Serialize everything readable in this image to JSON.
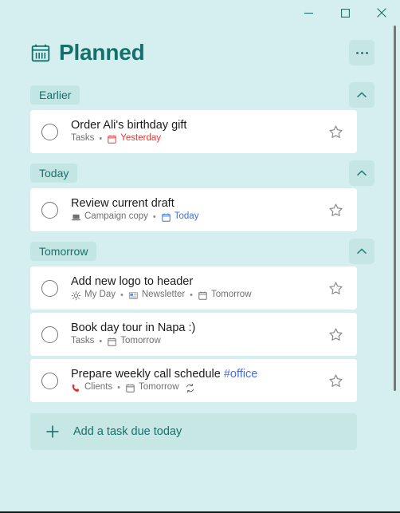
{
  "window": {
    "controls": [
      {
        "name": "minimize",
        "glyph": "minimize-icon"
      },
      {
        "name": "maximize",
        "glyph": "maximize-icon"
      },
      {
        "name": "close",
        "glyph": "close-icon"
      }
    ]
  },
  "header": {
    "title": "Planned",
    "icon": "calendar-icon",
    "more_label": "...",
    "more_name": "more-options-icon"
  },
  "colors": {
    "app_background": "#d5eef0",
    "accent_teal": "#13706b",
    "chip_background": "#c3e5e3",
    "card_background": "#ffffff",
    "overdue_red": "#e03b36",
    "today_blue": "#3a6fd8",
    "hashtag_blue": "#4a6fd4",
    "meta_gray": "#707070"
  },
  "groups": [
    {
      "label": "Earlier",
      "collapse_icon": "chevron-up-icon",
      "tasks": [
        {
          "title": "Order Ali's birthday gift",
          "title_hashtag": "",
          "checkbox": "task-checkbox",
          "star": "star-icon",
          "meta": [
            {
              "icon": "",
              "text": "Tasks",
              "style": "default"
            },
            {
              "icon": "calendar-icon",
              "text": "Yesterday",
              "style": "overdue"
            }
          ]
        }
      ]
    },
    {
      "label": "Today",
      "collapse_icon": "chevron-up-icon",
      "tasks": [
        {
          "title": "Review current draft",
          "title_hashtag": "",
          "checkbox": "task-checkbox",
          "star": "star-icon",
          "meta": [
            {
              "icon": "laptop-icon",
              "text": "Campaign copy",
              "style": "default"
            },
            {
              "icon": "calendar-icon",
              "text": "Today",
              "style": "today"
            }
          ]
        }
      ]
    },
    {
      "label": "Tomorrow",
      "collapse_icon": "chevron-up-icon",
      "tasks": [
        {
          "title": "Add new logo to header",
          "title_hashtag": "",
          "checkbox": "task-checkbox",
          "star": "star-icon",
          "meta": [
            {
              "icon": "sun-icon",
              "text": "My Day",
              "style": "default"
            },
            {
              "icon": "newspaper-icon",
              "text": "Newsletter",
              "style": "default"
            },
            {
              "icon": "calendar-icon",
              "text": "Tomorrow",
              "style": "default"
            }
          ]
        },
        {
          "title": "Book day tour in Napa :)",
          "title_hashtag": "",
          "checkbox": "task-checkbox",
          "star": "star-icon",
          "meta": [
            {
              "icon": "",
              "text": "Tasks",
              "style": "default"
            },
            {
              "icon": "calendar-icon",
              "text": "Tomorrow",
              "style": "default"
            }
          ]
        },
        {
          "title": "Prepare weekly call schedule ",
          "title_hashtag": "#office",
          "checkbox": "task-checkbox",
          "star": "star-icon",
          "meta": [
            {
              "icon": "phone-icon",
              "text": "Clients",
              "style": "default"
            },
            {
              "icon": "calendar-icon",
              "text": "Tomorrow",
              "style": "default",
              "trailing_icon": "repeat-icon"
            }
          ]
        }
      ]
    }
  ],
  "add_task": {
    "label": "Add a task due today",
    "icon": "plus-icon"
  }
}
